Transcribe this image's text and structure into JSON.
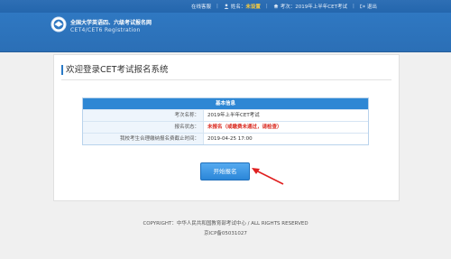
{
  "topbar": {
    "service": "在线客服",
    "name_label": "姓名：",
    "name_value": "未设置",
    "exam_label": "考次：",
    "exam_value": "2019年上半年CET考试",
    "logout": "退出"
  },
  "header": {
    "brand_cn": "全国大学英语四、六级考试报名网",
    "brand_en": "CET4/CET6  Registration"
  },
  "main": {
    "title": "欢迎登录CET考试报名系统"
  },
  "info_table": {
    "heading": "基本信息",
    "rows": [
      {
        "key": "考次名称：",
        "value": "2019年上半年CET考试"
      },
      {
        "key": "报名状态：",
        "value": "未报名（或缴费未通过，请检查）"
      },
      {
        "key": "我校考生合理缴纳报名费截止时间：",
        "value": "2019-04-25 17:00"
      }
    ]
  },
  "start_button": "开始报名",
  "footer": {
    "copyright": "COPYRIGHT：中华人民共和国教育部考试中心 / ALL RIGHTS RESERVED",
    "icp": "京ICP备05031027"
  },
  "colors": {
    "primary": "#2e6fb5",
    "table_head": "#2e87d4",
    "status_red": "#d9261c",
    "arrow_red": "#e02020"
  }
}
